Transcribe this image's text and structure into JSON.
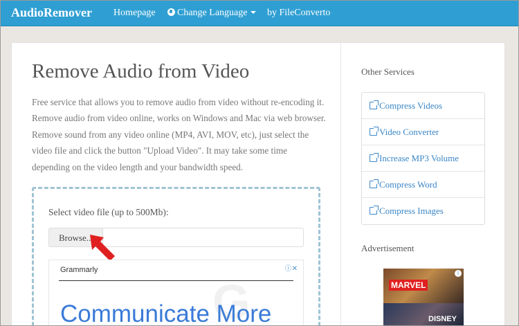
{
  "navbar": {
    "brand": "AudioRemover",
    "links": {
      "home": "Homepage",
      "language": "Change Language",
      "by": "by FileConverto"
    }
  },
  "main": {
    "title": "Remove Audio from Video",
    "description": "Free service that allows you to remove audio from video without re-encoding it. Remove audio from video online, works on Windows and Mac via web browser. Remove sound from any video online (MP4, AVI, MOV, etc), just select the video file and click the button \"Upload Video\". It may take some time depending on the video length and your bandwidth speed.",
    "upload": {
      "label": "Select video file (up to 500Mb):",
      "browse_label": "Browse..."
    },
    "ad": {
      "brand": "Grammarly",
      "headline": "Communicate More"
    }
  },
  "sidebar": {
    "services_heading": "Other Services",
    "services": [
      "Compress Videos",
      "Video Converter",
      "Increase MP3 Volume",
      "Compress Word",
      "Compress Images"
    ],
    "advertisement_heading": "Advertisement",
    "ad_texts": {
      "marvel": "MARVEL",
      "disney": "DISNEY"
    }
  },
  "colors": {
    "navbar": "#2f9fd3",
    "link": "#3a86c6",
    "dashed_border": "#9fc3d3",
    "arrow": "#e02020"
  },
  "icons": [
    "globe-icon",
    "caret-down-icon",
    "external-link-icon",
    "red-arrow-pointer",
    "ad-info-icon"
  ]
}
